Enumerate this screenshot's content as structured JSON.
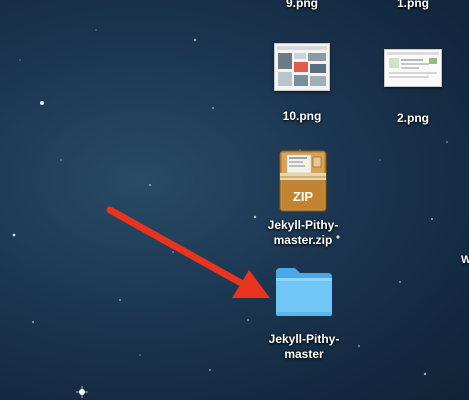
{
  "desktop": {
    "items": [
      {
        "label": "9.png"
      },
      {
        "label": "1.png"
      },
      {
        "label": "10.png"
      },
      {
        "label": "2.png"
      },
      {
        "label": "Jekyll-Pithy-\nmaster.zip",
        "badge": "ZIP"
      },
      {
        "label": "Jekyll-Pithy-\nmaster"
      }
    ],
    "edge_label": "W"
  },
  "colors": {
    "folder": "#6fc6f7",
    "arrow": "#e8331f",
    "zip_box": "#c98d3b"
  }
}
